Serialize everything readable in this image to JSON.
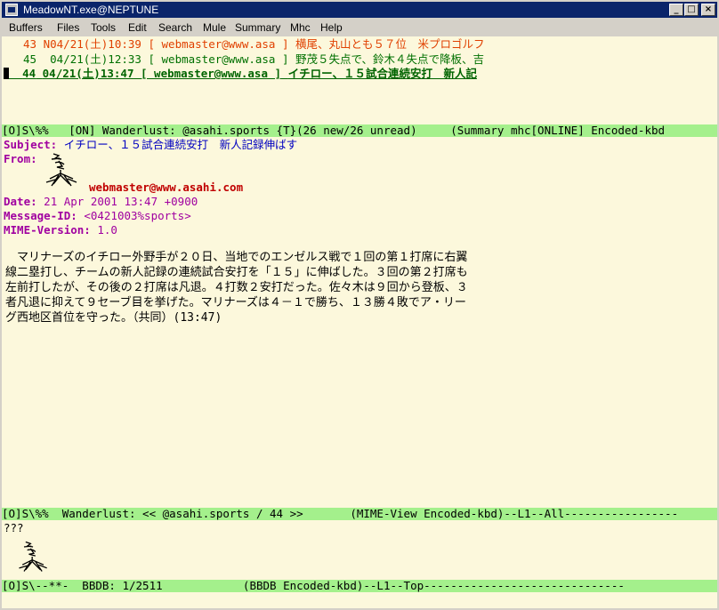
{
  "window": {
    "title": "MeadowNT.exe@NEPTUNE"
  },
  "menu": [
    "Buffers",
    "Files",
    "Tools",
    "Edit",
    "Search",
    "Mule",
    "Summary",
    "Mhc",
    "Help"
  ],
  "summary_lines": [
    {
      "num": "43",
      "flag": "N",
      "date": "04/21(土)10:39",
      "sender": "[ webmaster@www.asa ]",
      "subject": "横尾、丸山とも５７位　米プロゴルフ"
    },
    {
      "num": "45",
      "flag": " ",
      "date": "04/21(土)12:33",
      "sender": "[ webmaster@www.asa ]",
      "subject": "野茂５失点で、鈴木４失点で降板、吉"
    },
    {
      "num": "44",
      "flag": " ",
      "date": "04/21(土)13:47",
      "sender": "[ webmaster@www.asa ]",
      "subject": "イチロー、１５試合連続安打　新人記"
    }
  ],
  "summary_modeline": "[O]S\\%%   [ON] Wanderlust: @asahi.sports {T}(26 new/26 unread)     (Summary mhc[ONLINE] Encoded-kbd",
  "message": {
    "subject_label": "Subject:",
    "subject": "イチロー、１５試合連続安打　新人記録伸ばす",
    "from_label": "From:",
    "from_address": "webmaster@www.asahi.com",
    "date_label": "Date:",
    "date": "21 Apr 2001 13:47 +0900",
    "msgid_label": "Message-ID:",
    "msgid": "<0421003%sports>",
    "mime_label": "MIME-Version:",
    "mime": "1.0",
    "body": [
      "　マリナーズのイチロー外野手が２０日、当地でのエンゼルス戦で１回の第１打席に右翼",
      "線二塁打し、チームの新人記録の連続試合安打を「１５」に伸ばした。３回の第２打席も",
      "左前打したが、その後の２打席は凡退。４打数２安打だった。佐々木は９回から登板、３",
      "者凡退に抑えて９セーブ目を挙げた。マリナーズは４－１で勝ち、１３勝４敗でア・リー",
      "グ西地区首位を守った。（共同）(13:47)"
    ]
  },
  "message_modeline": "[O]S\\%%  Wanderlust: << @asahi.sports / 44 >>       (MIME-View Encoded-kbd)--L1--All-----------------",
  "bbdb_text": "???",
  "bbdb_modeline": "[O]S\\--**-  BBDB: 1/2511            (BBDB Encoded-kbd)--L1--Top------------------------------"
}
